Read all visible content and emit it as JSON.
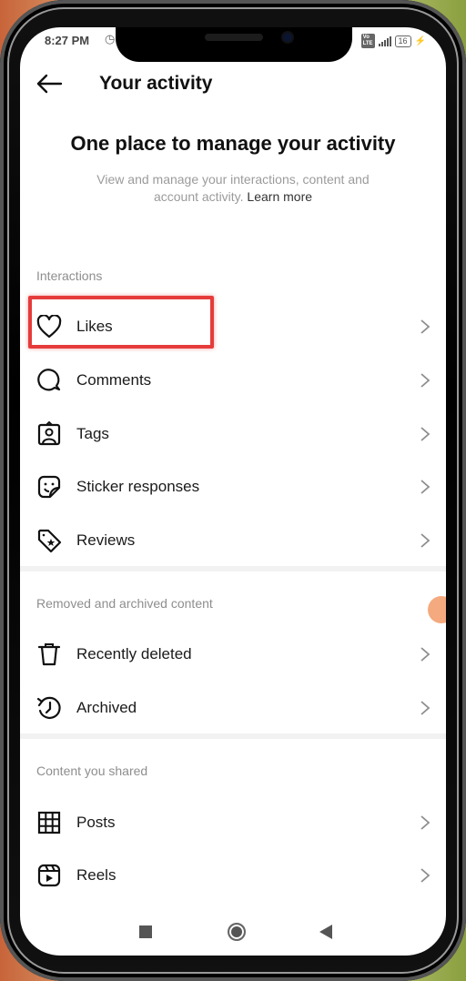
{
  "status_bar": {
    "time": "8:27 PM",
    "alarm_icon": "alarm-clock-icon",
    "network_badge": "Vo LTE",
    "battery_level": "16",
    "charging_icon": "lightning-bolt-icon"
  },
  "header": {
    "back_icon": "arrow-left-icon",
    "title": "Your activity"
  },
  "hero": {
    "title": "One place to manage your activity",
    "description": "View and manage your interactions, content and account activity.",
    "learn_more": "Learn more"
  },
  "sections": [
    {
      "label": "Interactions",
      "items": [
        {
          "label": "Likes",
          "icon": "heart-icon",
          "highlighted": true
        },
        {
          "label": "Comments",
          "icon": "comment-bubble-icon"
        },
        {
          "label": "Tags",
          "icon": "tag-person-icon"
        },
        {
          "label": "Sticker responses",
          "icon": "sticker-smile-icon"
        },
        {
          "label": "Reviews",
          "icon": "tag-star-icon"
        }
      ]
    },
    {
      "label": "Removed and archived content",
      "items": [
        {
          "label": "Recently deleted",
          "icon": "trash-icon"
        },
        {
          "label": "Archived",
          "icon": "archive-history-icon"
        }
      ]
    },
    {
      "label": "Content you shared",
      "items": [
        {
          "label": "Posts",
          "icon": "grid-icon"
        },
        {
          "label": "Reels",
          "icon": "reels-icon"
        }
      ]
    }
  ],
  "highlight_color": "#e63b3b",
  "nav_bar": {
    "recents": "square-icon",
    "home": "circle-icon",
    "back": "triangle-back-icon"
  }
}
